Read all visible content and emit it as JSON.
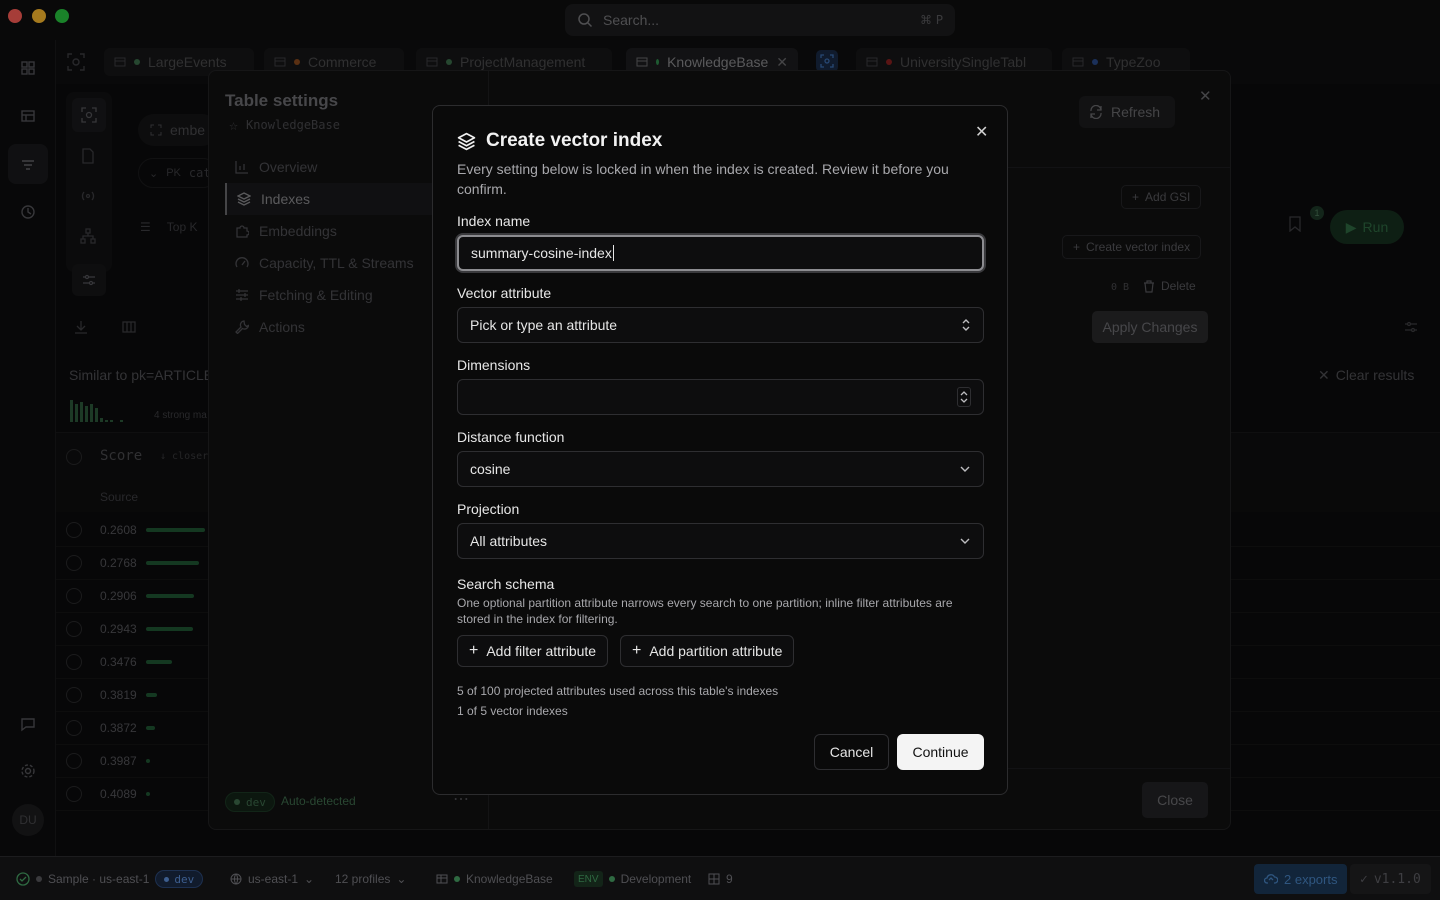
{
  "search": {
    "placeholder": "Search...",
    "shortcut": "⌘ P"
  },
  "tabs": [
    {
      "label": "LargeEvents",
      "dot": "#3b6d4a"
    },
    {
      "label": "Commerce",
      "dot": "#8a4a1e"
    },
    {
      "label": "ProjectManagement",
      "dot": "#3b6d4a"
    },
    {
      "label": "KnowledgeBase",
      "dot": "#2f8a4d",
      "active": true
    },
    {
      "label": "UniversitySingleTabl",
      "dot": "#8a2020"
    },
    {
      "label": "TypeZoo",
      "dot": "#2a4a8a"
    }
  ],
  "background": {
    "embed_chip": "embe",
    "pk_chip": "PK",
    "pk_text": "cat",
    "topk": "Top K",
    "similar_to": "Similar to pk=ARTICLE",
    "strong_matches": "4 strong ma",
    "score_header": "Score",
    "score_sub": "↓ closer",
    "source_header": "Source",
    "scores": [
      {
        "value": "0.2608",
        "fill": 0.95
      },
      {
        "value": "0.2768",
        "fill": 0.85
      },
      {
        "value": "0.2906",
        "fill": 0.78
      },
      {
        "value": "0.2943",
        "fill": 0.75
      },
      {
        "value": "0.3476",
        "fill": 0.42
      },
      {
        "value": "0.3819",
        "fill": 0.18
      },
      {
        "value": "0.3872",
        "fill": 0.14
      },
      {
        "value": "0.3987",
        "fill": 0.06
      },
      {
        "value": "0.4089",
        "fill": 0.0
      }
    ],
    "clear_results": "Clear results",
    "run": "Run",
    "badge_count": "1"
  },
  "settings": {
    "title": "Table settings",
    "table_name": "KnowledgeBase",
    "nav": [
      {
        "label": "Overview",
        "icon": "chart-icon"
      },
      {
        "label": "Indexes",
        "icon": "layers-icon",
        "active": true
      },
      {
        "label": "Embeddings",
        "icon": "puzzle-icon"
      },
      {
        "label": "Capacity, TTL & Streams",
        "icon": "gauge-icon"
      },
      {
        "label": "Fetching & Editing",
        "icon": "sliders-icon"
      },
      {
        "label": "Actions",
        "icon": "wrench-icon"
      }
    ],
    "env_badge": "dev",
    "auto_detected": "Auto-detected",
    "refresh": "Refresh",
    "add_gsi": "Add GSI",
    "create_vector_index": "Create vector index",
    "size": "0 B",
    "delete": "Delete",
    "apply_changes": "Apply Changes",
    "close": "Close"
  },
  "modal": {
    "title": "Create vector index",
    "description": "Every setting below is locked in when the index is created. Review it before you confirm.",
    "index_name_label": "Index name",
    "index_name_value": "summary-cosine-index",
    "vector_attr_label": "Vector attribute",
    "vector_attr_placeholder": "Pick or type an attribute",
    "dimensions_label": "Dimensions",
    "dimensions_value": "",
    "distance_label": "Distance function",
    "distance_value": "cosine",
    "projection_label": "Projection",
    "projection_value": "All attributes",
    "schema_label": "Search schema",
    "schema_help": "One optional partition attribute narrows every search to one partition; inline filter attributes are stored in the index for filtering.",
    "add_filter": "Add filter attribute",
    "add_partition": "Add partition attribute",
    "usage_projected": "5 of 100 projected attributes used across this table's indexes",
    "usage_vector": "1 of 5 vector indexes",
    "cancel": "Cancel",
    "continue": "Continue"
  },
  "statusbar": {
    "sample": "Sample · us-east-1",
    "env": "dev",
    "region": "us-east-1",
    "profiles": "12 profiles",
    "table": "KnowledgeBase",
    "env_tag": "ENV",
    "environment": "Development",
    "count": "9",
    "exports": "2 exports",
    "version": "v1.1.0"
  },
  "user_initials": "DU",
  "colors": {
    "accent_green": "#2f8a4d",
    "exports_blue": "#1b3a55",
    "score_bar": "#2f8a4d"
  }
}
